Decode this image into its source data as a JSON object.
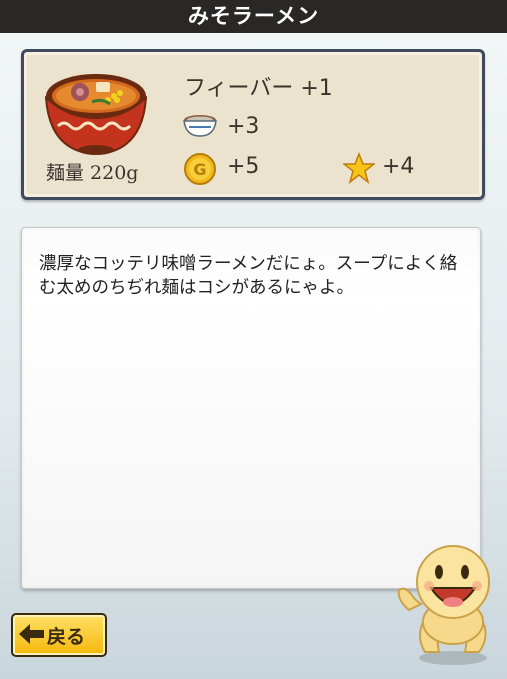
{
  "header": {
    "title": "みそラーメン"
  },
  "item": {
    "image": "miso-ramen-bowl",
    "noodle_amount": "麺量 220g",
    "stats": {
      "fever": "フィーバー +1",
      "bowl_bonus": "+3",
      "coin_bonus": "+5",
      "star_bonus": "+4"
    },
    "description": "濃厚なコッテリ味噌ラーメンだにょ。スープによく絡む太めのちぢれ麺はコシがあるにゃよ。"
  },
  "footer": {
    "back_label": "戻る"
  },
  "icons": {
    "bowl": "bowl-icon",
    "coin": "coin-icon",
    "star": "star-icon",
    "back": "left-arrow-icon",
    "mascot": "mascot-character"
  },
  "colors": {
    "title_bar": "#2a2727",
    "card_bg": "#ece3cf",
    "card_border": "#3f4a5f",
    "button": "#f5b80a",
    "coin": "#f2b81c",
    "star": "#f7c51a"
  }
}
